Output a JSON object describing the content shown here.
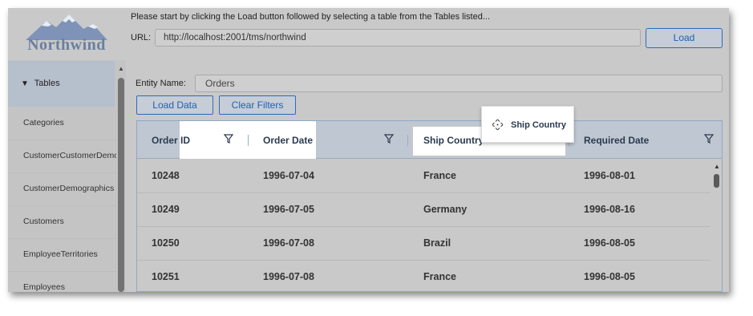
{
  "header": {
    "logo_text": "Northwind",
    "instruction": "Please start by clicking the Load button followed by selecting a table from the Tables listed...",
    "url_label": "URL:",
    "url_value": "http://localhost:2001/tms/northwind",
    "load_button": "Load"
  },
  "sidebar": {
    "tables_label": "Tables",
    "items": [
      {
        "label": "Categories"
      },
      {
        "label": "CustomerCustomerDemo"
      },
      {
        "label": "CustomerDemographics"
      },
      {
        "label": "Customers"
      },
      {
        "label": "EmployeeTerritories"
      },
      {
        "label": "Employees"
      }
    ]
  },
  "main": {
    "entity_label": "Entity Name:",
    "entity_value": "Orders",
    "load_data_button": "Load Data",
    "clear_filters_button": "Clear Filters"
  },
  "grid": {
    "columns": [
      {
        "label": "Order ID"
      },
      {
        "label": "Order Date"
      },
      {
        "label": "Ship Country"
      },
      {
        "label": "Required Date"
      }
    ],
    "rows": [
      {
        "order_id": "10248",
        "order_date": "1996-07-04",
        "ship_country": "France",
        "required_date": "1996-08-01"
      },
      {
        "order_id": "10249",
        "order_date": "1996-07-05",
        "ship_country": "Germany",
        "required_date": "1996-08-16"
      },
      {
        "order_id": "10250",
        "order_date": "1996-07-08",
        "ship_country": "Brazil",
        "required_date": "1996-08-05"
      },
      {
        "order_id": "10251",
        "order_date": "1996-07-08",
        "ship_country": "France",
        "required_date": "1996-08-05"
      }
    ]
  },
  "drag_chip": {
    "label": "Ship Country"
  },
  "colors": {
    "accent": "#1f5fb5",
    "overlay": "#c9c9c9",
    "header_bg": "#bfc7d2"
  }
}
